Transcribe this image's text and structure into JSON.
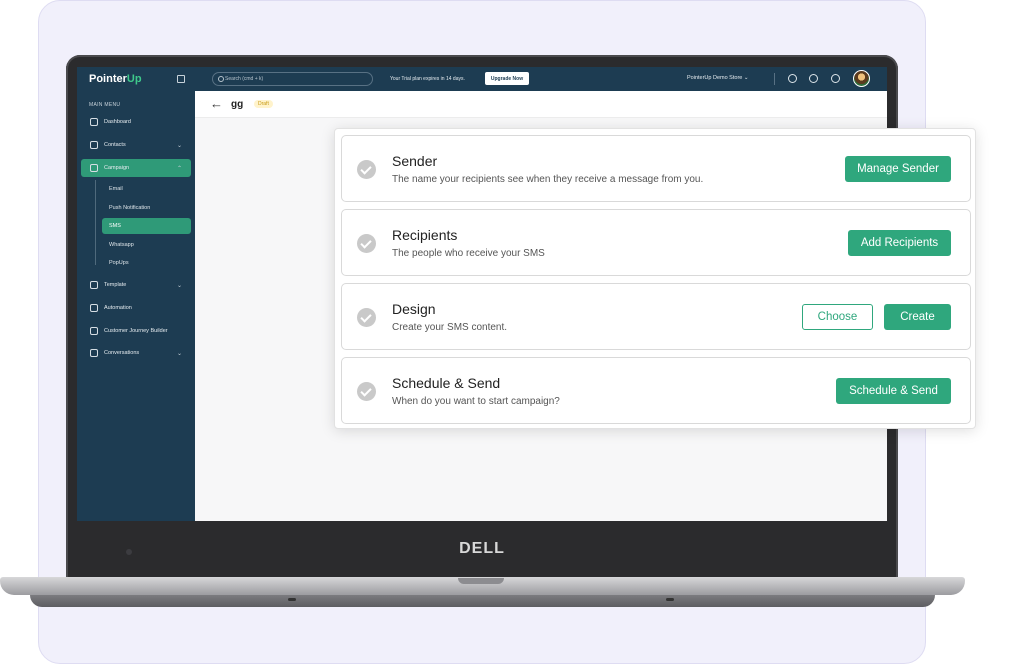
{
  "app": {
    "logo_main": "Pointer",
    "logo_accent": "Up",
    "laptop_brand": "DELL"
  },
  "sidebar": {
    "menu_heading": "MAIN MENU",
    "items": [
      {
        "label": "Dashboard"
      },
      {
        "label": "Contacts"
      },
      {
        "label": "Campaign"
      },
      {
        "label": "Template"
      },
      {
        "label": "Automation"
      },
      {
        "label": "Customer Journey Builder"
      },
      {
        "label": "Conversations"
      }
    ],
    "campaign_sub": [
      {
        "label": "Email"
      },
      {
        "label": "Push Notification"
      },
      {
        "label": "SMS"
      },
      {
        "label": "Whatsapp"
      },
      {
        "label": "PopUps"
      }
    ]
  },
  "topbar": {
    "search_placeholder": "Search (cmd + k)",
    "trial_text": "Your Trial plan expires in 14 days.",
    "upgrade_label": "Upgrade Now",
    "store_name": "PointerUp Demo Store"
  },
  "page": {
    "title": "gg",
    "status": "Draft"
  },
  "steps": [
    {
      "title": "Sender",
      "subtitle": "The name your recipients see when they receive a message from you.",
      "button": "Manage Sender"
    },
    {
      "title": "Recipients",
      "subtitle": "The people who receive your SMS",
      "button": "Add Recipients"
    },
    {
      "title": "Design",
      "subtitle": "Create your SMS content.",
      "button_secondary": "Choose",
      "button": "Create"
    },
    {
      "title": "Schedule & Send",
      "subtitle": "When do you want to start campaign?",
      "button": "Schedule & Send"
    }
  ],
  "colors": {
    "sidebar_bg": "#1d3c52",
    "accent": "#2fa77d",
    "draft_badge": "#fff3cc"
  }
}
